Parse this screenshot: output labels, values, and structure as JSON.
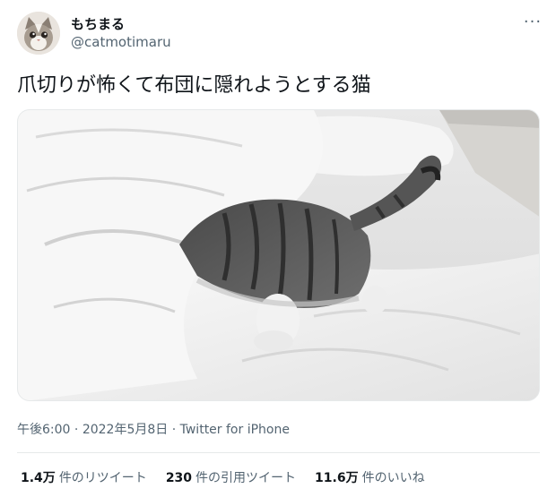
{
  "author": {
    "display_name": "もちまる",
    "handle": "@catmotimaru",
    "avatar_icon": "cat-face-avatar"
  },
  "menu": {
    "icon": "more-dots-icon",
    "label": "···"
  },
  "tweet": {
    "text": "爪切りが怖くて布団に隠れようとする猫"
  },
  "media": {
    "description_icon": "tweet-photo-image"
  },
  "meta": {
    "time": "午後6:00",
    "separator1": " · ",
    "date": "2022年5月8日",
    "separator2": " · ",
    "source": "Twitter for iPhone"
  },
  "stats": {
    "retweets_count": "1.4万",
    "retweets_label": "件のリツイート",
    "quotes_count": "230",
    "quotes_label": "件の引用ツイート",
    "likes_count": "11.6万",
    "likes_label": "件のいいね"
  },
  "colors": {
    "text_primary": "#0f1419",
    "text_secondary": "#536471",
    "divider": "#e6e9ea"
  }
}
